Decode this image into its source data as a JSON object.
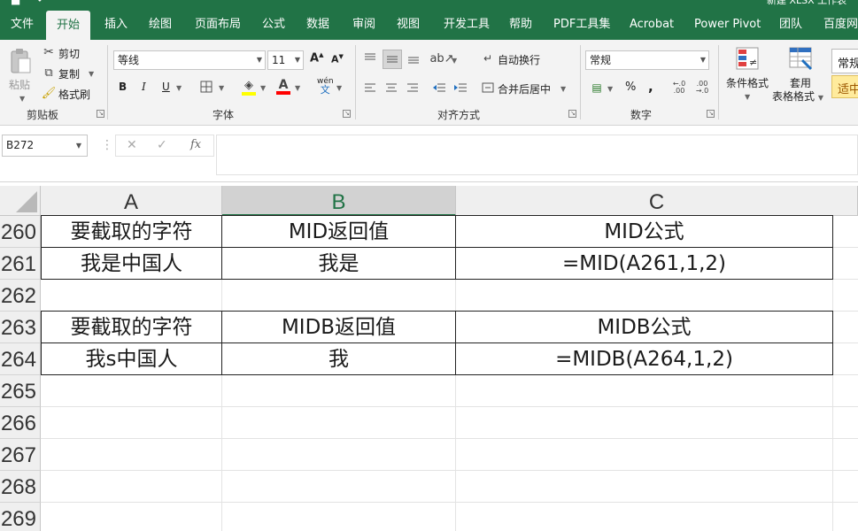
{
  "title_fragment": "新建 XLSX 工作表",
  "tabs": [
    {
      "label": "文件",
      "active": false
    },
    {
      "label": "开始",
      "active": true
    },
    {
      "label": "插入",
      "active": false
    },
    {
      "label": "绘图",
      "active": false
    },
    {
      "label": "页面布局",
      "active": false
    },
    {
      "label": "公式",
      "active": false
    },
    {
      "label": "数据",
      "active": false
    },
    {
      "label": "审阅",
      "active": false
    },
    {
      "label": "视图",
      "active": false
    },
    {
      "label": "开发工具",
      "active": false
    },
    {
      "label": "帮助",
      "active": false
    },
    {
      "label": "PDF工具集",
      "active": false
    },
    {
      "label": "Acrobat",
      "active": false
    },
    {
      "label": "Power Pivot",
      "active": false
    },
    {
      "label": "团队",
      "active": false
    },
    {
      "label": "百度网盘",
      "active": false
    }
  ],
  "ribbon": {
    "clipboard": {
      "paste": "粘贴",
      "cut": "剪切",
      "copy": "复制",
      "format_painter": "格式刷",
      "label": "剪贴板"
    },
    "font": {
      "font_name": "等线",
      "font_size": "11",
      "grow": "A",
      "shrink": "A",
      "bold": "B",
      "italic": "I",
      "underline": "U",
      "font_color_letter": "A",
      "phonetic": "wén",
      "label": "字体",
      "highlight_color": "#ffff00",
      "font_color": "#ff0000"
    },
    "alignment": {
      "wrap_text": "自动换行",
      "merge_center": "合并后居中",
      "label": "对齐方式"
    },
    "number": {
      "format": "常规",
      "percent": "%",
      "comma": ",",
      "label": "数字"
    },
    "styles": {
      "conditional_formatting": "条件格式",
      "format_as_table_line1": "套用",
      "format_as_table_line2": "表格格式",
      "style_normal": "常规",
      "style_neutral": "适中"
    }
  },
  "formula_bar": {
    "name_box": "B272",
    "cancel": "✕",
    "enter": "✓",
    "fx": "fx",
    "value": ""
  },
  "sheet": {
    "columns": [
      "A",
      "B",
      "C"
    ],
    "selected_column": "B",
    "rows": [
      {
        "num": "260",
        "cells": [
          "要截取的字符",
          "MID返回值",
          "MID公式"
        ]
      },
      {
        "num": "261",
        "cells": [
          "我是中国人",
          "我是",
          "=MID(A261,1,2)"
        ]
      },
      {
        "num": "262",
        "cells": [
          "",
          "",
          ""
        ]
      },
      {
        "num": "263",
        "cells": [
          "要截取的字符",
          "MIDB返回值",
          "MIDB公式"
        ]
      },
      {
        "num": "264",
        "cells": [
          "我s中国人",
          "我",
          "=MIDB(A264,1,2)"
        ]
      },
      {
        "num": "265",
        "cells": [
          "",
          "",
          ""
        ]
      },
      {
        "num": "266",
        "cells": [
          "",
          "",
          ""
        ]
      },
      {
        "num": "267",
        "cells": [
          "",
          "",
          ""
        ]
      },
      {
        "num": "268",
        "cells": [
          "",
          "",
          ""
        ]
      },
      {
        "num": "269",
        "cells": [
          "",
          "",
          ""
        ]
      }
    ]
  },
  "colors": {
    "accent": "#217346",
    "ribbon_bg": "#f3f3f3"
  }
}
